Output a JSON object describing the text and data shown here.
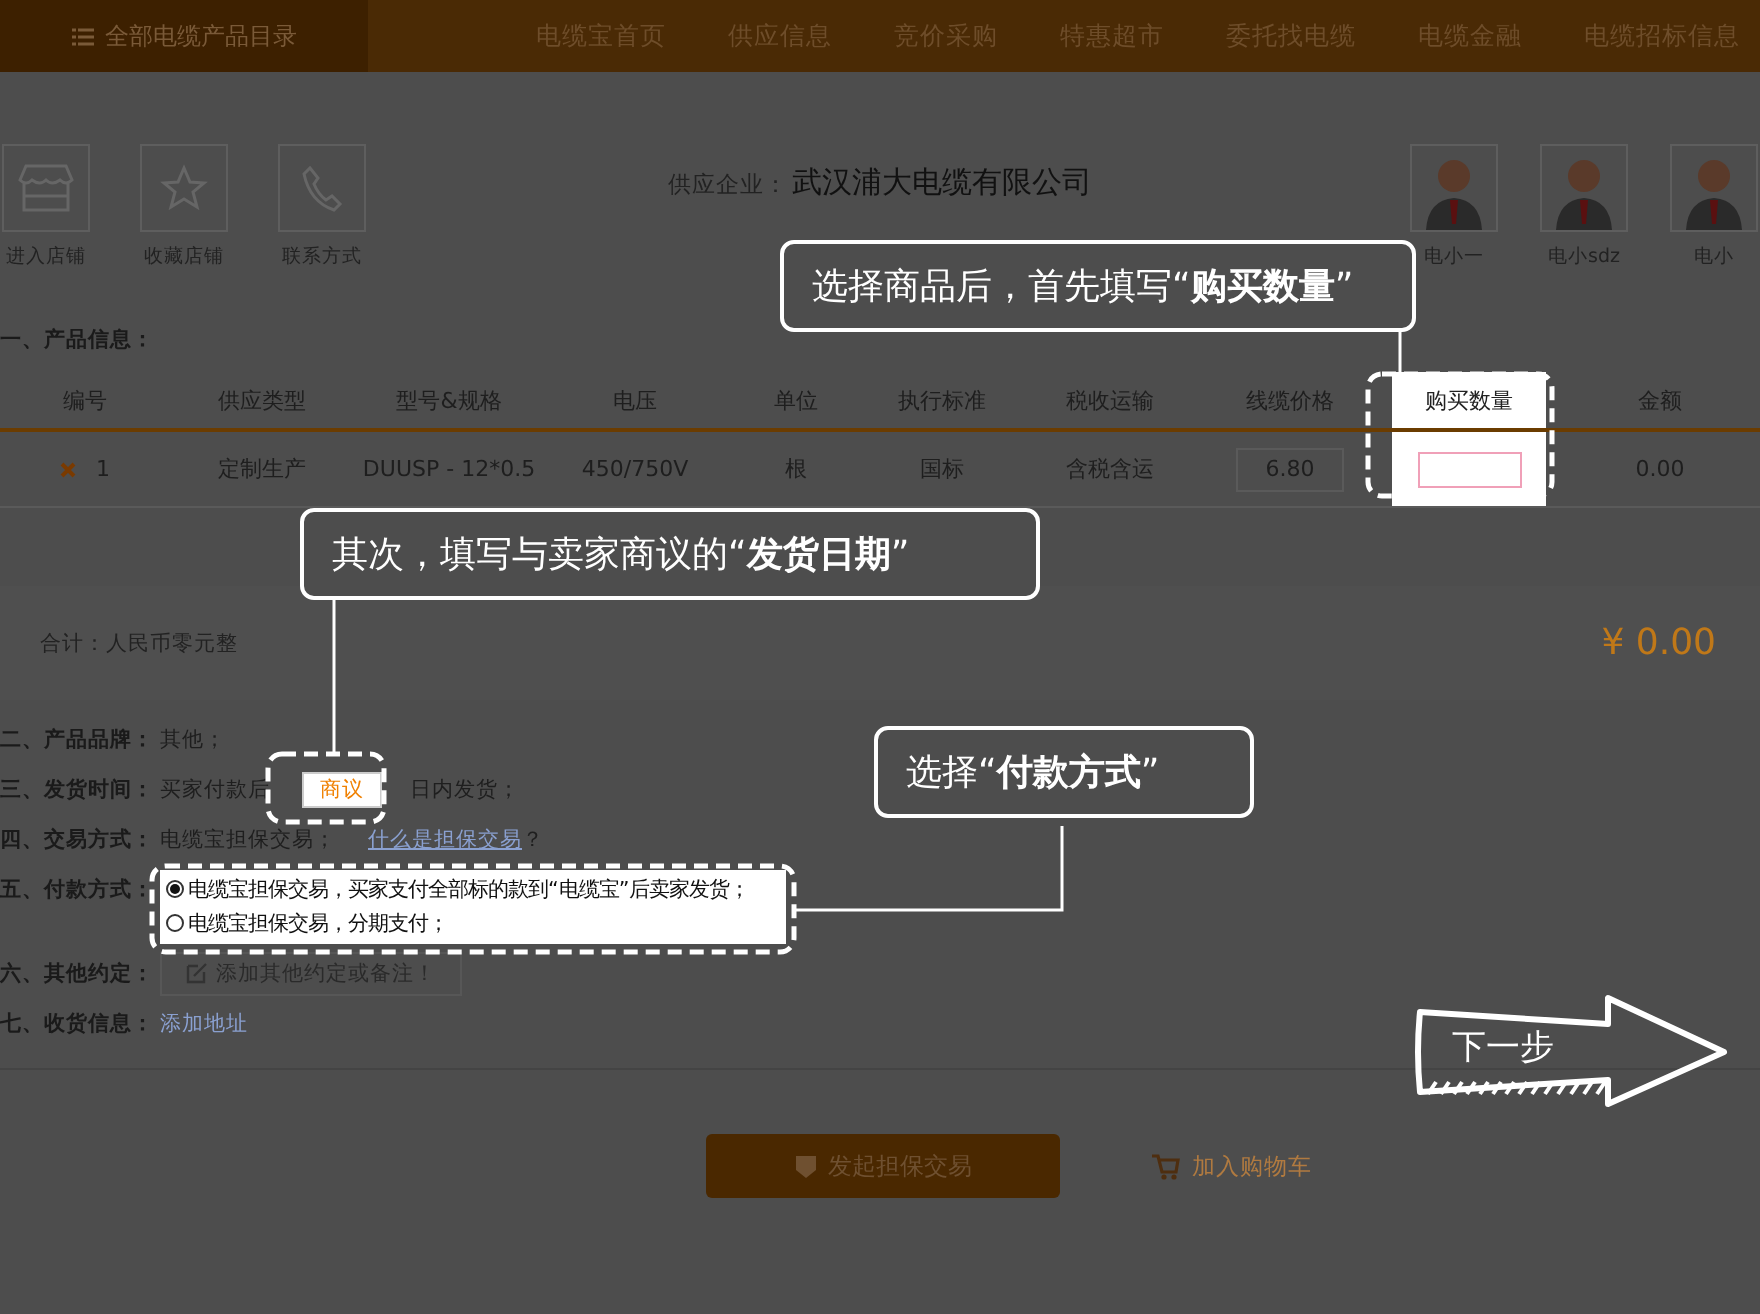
{
  "nav": {
    "category_menu": "全部电缆产品目录",
    "links": [
      "电缆宝首页",
      "供应信息",
      "竞价采购",
      "特惠超市",
      "委托找电缆",
      "电缆金融",
      "电缆招标信息"
    ]
  },
  "shop": {
    "actions": [
      "进入店铺",
      "收藏店铺",
      "联系方式"
    ],
    "supplier_label": "供应企业：",
    "supplier_name": "武汉浦大电缆有限公司",
    "agents": [
      "电小一",
      "电小sdz",
      "电小"
    ]
  },
  "product_info": {
    "heading": "一、产品信息：",
    "columns": [
      "编号",
      "供应类型",
      "型号&规格",
      "电压",
      "单位",
      "执行标准",
      "税收运输",
      "线缆价格",
      "购买数量",
      "金额"
    ],
    "rows": [
      {
        "number": "1",
        "supply_type": "定制生产",
        "model": "DUUSP - 12*0.5",
        "voltage": "450/750V",
        "unit": "根",
        "standard": "国标",
        "shipping": "含税含运",
        "price": "6.80",
        "amount": "0.00"
      }
    ]
  },
  "total": {
    "label": "合计：人民币零元整",
    "amount": "¥ 0.00"
  },
  "details": [
    {
      "kind": "text",
      "label": "二、产品品牌：",
      "value": "其他；"
    },
    {
      "kind": "delivery",
      "label": "三、发货时间：",
      "before": "买家付款后",
      "button": "商议",
      "after": "日内发货；"
    },
    {
      "kind": "trade",
      "label": "四、交易方式：",
      "value": "电缆宝担保交易；",
      "link": "什么是担保交易",
      "suffix": "？"
    },
    {
      "kind": "payment",
      "label": "五、付款方式：",
      "options": [
        {
          "label": "电缆宝担保交易，买家支付全部标的款到“电缆宝”后卖家发货；",
          "selected": true
        },
        {
          "label": "电缆宝担保交易，分期支付；",
          "selected": false
        }
      ]
    },
    {
      "kind": "remarks",
      "label": "六、其他约定：",
      "button": "添加其他约定或备注！"
    },
    {
      "kind": "address",
      "label": "七、收货信息：",
      "link": "添加地址"
    }
  ],
  "actions": {
    "primary": "发起担保交易",
    "secondary": "加入购物车"
  },
  "guide": {
    "steps": [
      "选择商品后，首先填写“**购买数量**”",
      "其次，填写与卖家商议的“**发货日期**”",
      "选择“**付款方式**”"
    ],
    "next": "下一步"
  }
}
